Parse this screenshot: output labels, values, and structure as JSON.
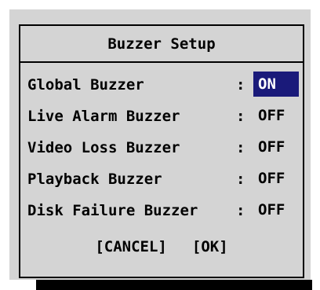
{
  "dialog": {
    "title": "Buzzer Setup",
    "colon": ":",
    "settings": [
      {
        "label": "Global Buzzer",
        "value": "ON",
        "selected": true
      },
      {
        "label": "Live Alarm Buzzer",
        "value": "OFF",
        "selected": false
      },
      {
        "label": "Video Loss Buzzer",
        "value": "OFF",
        "selected": false
      },
      {
        "label": "Playback Buzzer",
        "value": "OFF",
        "selected": false
      },
      {
        "label": "Disk Failure Buzzer",
        "value": "OFF",
        "selected": false
      }
    ],
    "buttons": {
      "cancel_label": "[CANCEL]",
      "ok_label": "[OK]"
    }
  },
  "colors": {
    "panel_bg": "#d4d4d4",
    "selection_bg": "#1a1a7a",
    "selection_fg": "#ffffff",
    "text": "#000000"
  }
}
